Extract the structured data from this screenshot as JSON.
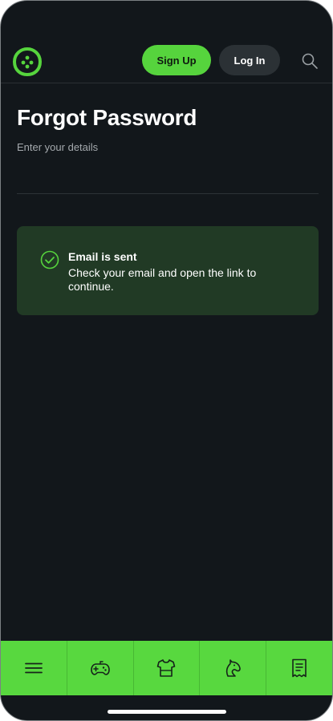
{
  "header": {
    "logo_icon": "clover-logo-icon",
    "signup_label": "Sign Up",
    "login_label": "Log In",
    "search_icon": "search-icon"
  },
  "page": {
    "title": "Forgot Password",
    "subtitle": "Enter your details"
  },
  "alert": {
    "icon": "check-circle-icon",
    "title": "Email is sent",
    "message": "Check your email and open the link to continue."
  },
  "bottom_nav": {
    "items": [
      {
        "icon": "menu-icon"
      },
      {
        "icon": "gamepad-icon"
      },
      {
        "icon": "jersey-icon"
      },
      {
        "icon": "horse-icon"
      },
      {
        "icon": "receipt-icon"
      }
    ]
  },
  "colors": {
    "background": "#12171b",
    "accent": "#56d43d",
    "alert_bg": "#213a25"
  }
}
